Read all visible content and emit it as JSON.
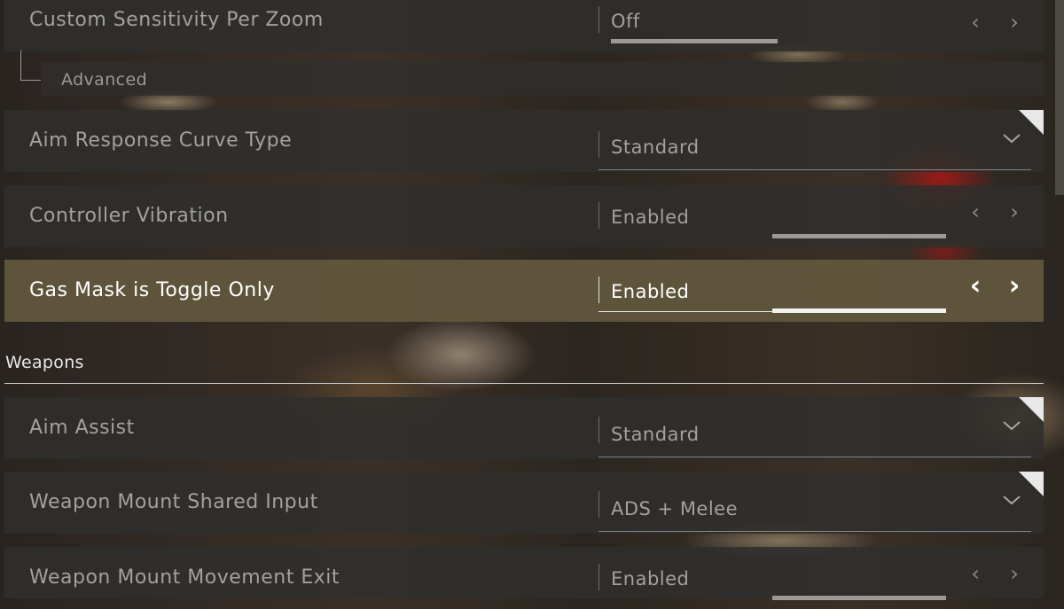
{
  "settings": {
    "custom_sensitivity": {
      "label": "Custom Sensitivity Per Zoom",
      "value": "Off"
    },
    "advanced": {
      "label": "Advanced"
    },
    "aim_response": {
      "label": "Aim Response Curve Type",
      "value": "Standard"
    },
    "controller_vibration": {
      "label": "Controller Vibration",
      "value": "Enabled"
    },
    "gas_mask": {
      "label": "Gas Mask is Toggle Only",
      "value": "Enabled"
    },
    "weapons_section": {
      "title": "Weapons"
    },
    "aim_assist": {
      "label": "Aim Assist",
      "value": "Standard"
    },
    "weapon_mount_input": {
      "label": "Weapon Mount Shared Input",
      "value": "ADS + Melee"
    },
    "weapon_mount_exit": {
      "label": "Weapon Mount Movement Exit",
      "value": "Enabled"
    }
  },
  "icons": {
    "prev": "chevron-left-icon",
    "next": "chevron-right-icon",
    "dropdown": "chevron-down-icon"
  },
  "arrows": {
    "left": "‹",
    "right": "›"
  },
  "colors": {
    "row_bg": "#302e2c",
    "selected_bg": "#60563c",
    "text": "#a2a19f",
    "selected_text": "#ffffff"
  }
}
